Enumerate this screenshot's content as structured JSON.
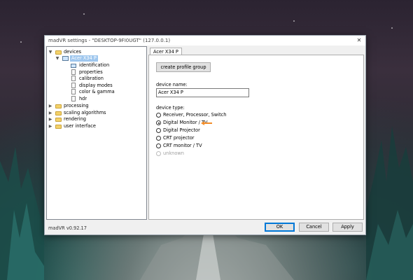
{
  "window": {
    "title": "madVR settings - \"DESKTOP-9FI0UGT\" (127.0.0.1)",
    "close_glyph": "✕"
  },
  "tree": {
    "devices": "devices",
    "device_selected": "Acer X34 P",
    "device_children": [
      "identification",
      "properties",
      "calibration",
      "display modes",
      "color & gamma",
      "hdr"
    ],
    "other_folders": [
      "processing",
      "scaling algorithms",
      "rendering",
      "user interface"
    ]
  },
  "tab": {
    "label": "Acer X34 P"
  },
  "panel": {
    "create_profile_group": "create profile group",
    "device_name_label": "device name:",
    "device_name_value": "Acer X34 P",
    "device_type_label": "device type:",
    "device_types": [
      {
        "label": "Receiver, Processor, Switch",
        "selected": false,
        "disabled": false
      },
      {
        "label": "Digital Monitor / TV",
        "selected": true,
        "disabled": false
      },
      {
        "label": "Digital Projector",
        "selected": false,
        "disabled": false
      },
      {
        "label": "CRT projector",
        "selected": false,
        "disabled": false
      },
      {
        "label": "CRT monitor / TV",
        "selected": false,
        "disabled": false
      },
      {
        "label": "unknown",
        "selected": false,
        "disabled": true
      }
    ]
  },
  "footer": {
    "version": "madVR v0.92.17",
    "ok": "OK",
    "cancel": "Cancel",
    "apply": "Apply"
  },
  "colors": {
    "accent_arrow": "#f28c28",
    "selection": "#9fc7ee",
    "default_button_border": "#0078d7"
  }
}
